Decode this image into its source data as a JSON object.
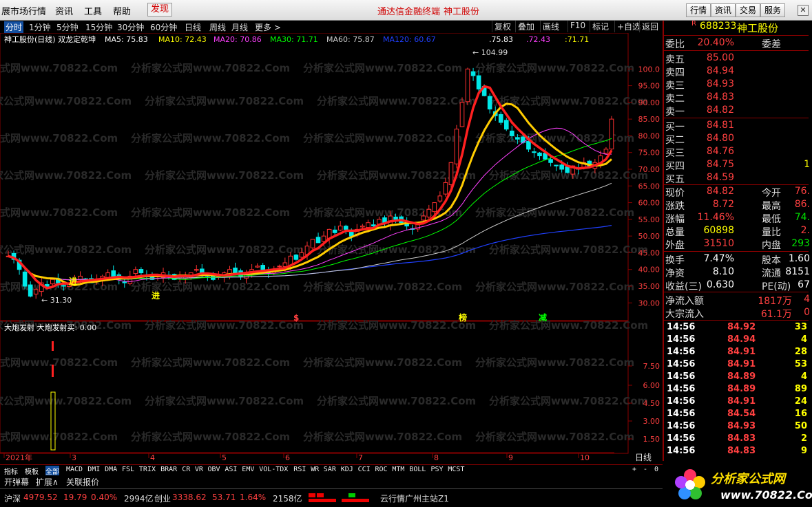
{
  "menubar": {
    "items": [
      "展市场行情",
      "资讯",
      "工具",
      "帮助"
    ],
    "discover": "发现",
    "center_a": "通达信金融终端",
    "center_b": "神工股份",
    "right_buttons": [
      "行情",
      "资讯",
      "交易",
      "服务"
    ]
  },
  "periods": [
    "分时",
    "1分钟",
    "5分钟",
    "15分钟",
    "30分钟",
    "60分钟",
    "日线",
    "周线",
    "月线",
    "更多 >"
  ],
  "toolbar": [
    "复权",
    "叠加",
    "画线",
    "F10",
    "标记",
    "+自选",
    "返回"
  ],
  "chart": {
    "title": "神工股份(日线) 双龙定乾坤",
    "ma_labels": [
      {
        "text": "MA5: 75.83",
        "color": "#ffffff"
      },
      {
        "text": "MA10: 72.43",
        "color": "#ffff00"
      },
      {
        "text": "MA20: 70.86",
        "color": "#ff40ff"
      },
      {
        "text": "MA30: 71.71",
        "color": "#00ff00"
      },
      {
        "text": "MA60: 75.87",
        "color": "#cccccc"
      },
      {
        "text": "MA120: 60.67",
        "color": "#2040ff"
      }
    ],
    "ma_overlay": [
      ".75.83",
      ".72.43",
      ":71.71"
    ],
    "high_label": "104.99",
    "low_label": "31.30",
    "price_ticks": [
      "100.0",
      "95.00",
      "90.00",
      "85.00",
      "80.00",
      "75.00",
      "70.00",
      "65.00",
      "60.00",
      "55.00",
      "50.00",
      "45.00",
      "40.00",
      "35.00",
      "30.00"
    ],
    "markers": [
      "进",
      "进",
      "$",
      "榜",
      "减"
    ],
    "sub_title": "大炮发射  大炮发射买: 0.00",
    "sub_ticks": [
      "7.50",
      "6.00",
      "4.50",
      "3.00",
      "1.50"
    ],
    "months": [
      "2021年",
      "3",
      "4",
      "5",
      "6",
      "7",
      "8",
      "9",
      "10"
    ],
    "period_tag": "日线",
    "watermark": "分析家公式网www.70822.Com"
  },
  "indicators": [
    "指标",
    "模板",
    "全部",
    "MACD",
    "DMI",
    "DMA",
    "FSL",
    "TRIX",
    "BRAR",
    "CR",
    "VR",
    "OBV",
    "ASI",
    "EMV",
    "VOL-TDX",
    "RSI",
    "WR",
    "SAR",
    "KDJ",
    "CCI",
    "ROC",
    "MTM",
    "BOLL",
    "PSY",
    "MCST"
  ],
  "subtabs": [
    "开弹幕",
    "扩展∧",
    "关联报价"
  ],
  "status": {
    "sh_label": "沪深",
    "sh_val": "4979.52",
    "sh_chg": "19.79",
    "sh_pct": "0.40%",
    "sh_amt": "2994亿",
    "cy_label": "创业",
    "cy_val": "3338.62",
    "cy_chg": "53.71",
    "cy_pct": "1.64%",
    "cy_amt": "2158亿",
    "server": "云行情广州主站Z1"
  },
  "quote": {
    "code": "688233",
    "name": "神工股份",
    "r_tag": "R",
    "weibi": {
      "label": "委比",
      "val": "20.40%",
      "label2": "委差"
    },
    "sells": [
      {
        "l": "卖五",
        "p": "85.00"
      },
      {
        "l": "卖四",
        "p": "84.94"
      },
      {
        "l": "卖三",
        "p": "84.93"
      },
      {
        "l": "卖二",
        "p": "84.83"
      },
      {
        "l": "卖一",
        "p": "84.82"
      }
    ],
    "buys": [
      {
        "l": "买一",
        "p": "84.81"
      },
      {
        "l": "买二",
        "p": "84.80"
      },
      {
        "l": "买三",
        "p": "84.76"
      },
      {
        "l": "买四",
        "p": "84.75",
        "v": "1"
      },
      {
        "l": "买五",
        "p": "84.59"
      }
    ],
    "stats": [
      {
        "l": "现价",
        "v": "84.82",
        "c": "red",
        "l2": "今开",
        "v2": "76.",
        "c2": "red"
      },
      {
        "l": "涨跌",
        "v": "8.72",
        "c": "red",
        "l2": "最高",
        "v2": "86.",
        "c2": "red"
      },
      {
        "l": "涨幅",
        "v": "11.46%",
        "c": "red",
        "l2": "最低",
        "v2": "74.",
        "c2": "grn"
      },
      {
        "l": "总量",
        "v": "60898",
        "c": "yel",
        "l2": "量比",
        "v2": "2.",
        "c2": "red"
      },
      {
        "l": "外盘",
        "v": "31510",
        "c": "red",
        "l2": "内盘",
        "v2": "293",
        "c2": "grn"
      },
      {
        "l": "换手",
        "v": "7.47%",
        "c": "wht",
        "l2": "股本",
        "v2": "1.60",
        "c2": "wht"
      },
      {
        "l": "净资",
        "v": "8.10",
        "c": "wht",
        "l2": "流通",
        "v2": "8151",
        "c2": "wht"
      },
      {
        "l": "收益(三)",
        "v": "0.630",
        "c": "wht",
        "l2": "PE(动)",
        "v2": "67",
        "c2": "wht"
      }
    ],
    "flows": [
      {
        "l": "净流入额",
        "v": "1817万",
        "v2": "4"
      },
      {
        "l": "大宗流入",
        "v": "61.1万",
        "v2": "0"
      }
    ],
    "ticks": [
      {
        "t": "14:56",
        "p": "84.92",
        "v": "33"
      },
      {
        "t": "14:56",
        "p": "84.94",
        "v": "4"
      },
      {
        "t": "14:56",
        "p": "84.91",
        "v": "28"
      },
      {
        "t": "14:56",
        "p": "84.91",
        "v": "53"
      },
      {
        "t": "14:56",
        "p": "84.89",
        "v": "4"
      },
      {
        "t": "14:56",
        "p": "84.89",
        "v": "89"
      },
      {
        "t": "14:56",
        "p": "84.91",
        "v": "24"
      },
      {
        "t": "14:56",
        "p": "84.54",
        "v": "16"
      },
      {
        "t": "14:56",
        "p": "84.93",
        "v": "50"
      },
      {
        "t": "14:56",
        "p": "84.83",
        "v": "2"
      },
      {
        "t": "14:56",
        "p": "84.83",
        "v": "9"
      }
    ]
  },
  "logo": {
    "name": "分析家公式网",
    "url": "www.70822.Com"
  },
  "chart_data": {
    "type": "candlestick",
    "ohlc_closes": [
      44,
      43,
      40,
      35,
      32,
      34,
      36,
      35,
      37,
      36,
      35,
      36,
      37,
      38,
      37,
      36,
      37,
      38,
      39,
      38,
      37,
      36,
      38,
      40,
      39,
      38,
      37,
      38,
      39,
      38,
      37,
      38,
      38,
      39,
      40,
      39,
      38,
      37,
      38,
      39,
      40,
      39,
      38,
      39,
      40,
      41,
      40,
      39,
      40,
      41,
      42,
      44,
      43,
      45,
      47,
      49,
      48,
      50,
      52,
      51,
      53,
      52,
      50,
      52,
      53,
      54,
      53,
      55,
      54,
      56,
      55,
      54,
      53,
      52,
      54,
      56,
      58,
      60,
      62,
      66,
      72,
      82,
      90,
      100,
      98,
      94,
      92,
      88,
      86,
      84,
      82,
      80,
      79,
      78,
      76,
      75,
      74,
      73,
      72,
      71,
      70,
      69,
      71,
      70,
      72,
      71,
      72,
      74,
      76,
      85
    ]
  }
}
